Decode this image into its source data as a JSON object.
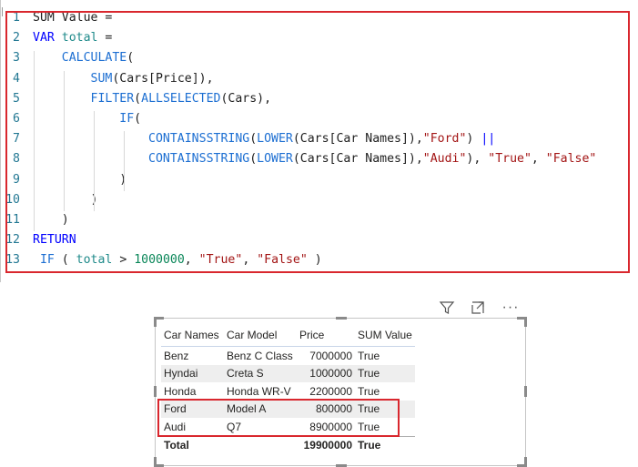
{
  "editor": {
    "lines": [
      {
        "n": "1",
        "tokens": [
          {
            "t": "SUM Value =",
            "c": "plain"
          }
        ]
      },
      {
        "n": "2",
        "tokens": [
          {
            "t": "VAR",
            "c": "kw"
          },
          {
            "t": " total",
            "c": "var"
          },
          {
            "t": " =",
            "c": "plain"
          }
        ]
      },
      {
        "n": "3",
        "tokens": [
          {
            "t": "    ",
            "c": "plain"
          },
          {
            "t": "CALCULATE",
            "c": "fn"
          },
          {
            "t": "(",
            "c": "plain"
          }
        ]
      },
      {
        "n": "4",
        "tokens": [
          {
            "t": "        ",
            "c": "plain"
          },
          {
            "t": "SUM",
            "c": "fn"
          },
          {
            "t": "(Cars[Price]),",
            "c": "plain"
          }
        ]
      },
      {
        "n": "5",
        "tokens": [
          {
            "t": "        ",
            "c": "plain"
          },
          {
            "t": "FILTER",
            "c": "fn"
          },
          {
            "t": "(",
            "c": "plain"
          },
          {
            "t": "ALLSELECTED",
            "c": "fn"
          },
          {
            "t": "(Cars),",
            "c": "plain"
          }
        ]
      },
      {
        "n": "6",
        "tokens": [
          {
            "t": "            ",
            "c": "plain"
          },
          {
            "t": "IF",
            "c": "fn"
          },
          {
            "t": "(",
            "c": "plain"
          }
        ]
      },
      {
        "n": "7",
        "tokens": [
          {
            "t": "                ",
            "c": "plain"
          },
          {
            "t": "CONTAINSSTRING",
            "c": "fn"
          },
          {
            "t": "(",
            "c": "plain"
          },
          {
            "t": "LOWER",
            "c": "fn"
          },
          {
            "t": "(Cars[Car Names]),",
            "c": "plain"
          },
          {
            "t": "\"Ford\"",
            "c": "str"
          },
          {
            "t": ") ",
            "c": "plain"
          },
          {
            "t": "||",
            "c": "kw"
          }
        ]
      },
      {
        "n": "8",
        "tokens": [
          {
            "t": "                ",
            "c": "plain"
          },
          {
            "t": "CONTAINSSTRING",
            "c": "fn"
          },
          {
            "t": "(",
            "c": "plain"
          },
          {
            "t": "LOWER",
            "c": "fn"
          },
          {
            "t": "(Cars[Car Names]),",
            "c": "plain"
          },
          {
            "t": "\"Audi\"",
            "c": "str"
          },
          {
            "t": "), ",
            "c": "plain"
          },
          {
            "t": "\"True\"",
            "c": "str"
          },
          {
            "t": ", ",
            "c": "plain"
          },
          {
            "t": "\"False\"",
            "c": "str"
          }
        ]
      },
      {
        "n": "9",
        "tokens": [
          {
            "t": "            )",
            "c": "plain"
          }
        ]
      },
      {
        "n": "10",
        "tokens": [
          {
            "t": "        )",
            "c": "plain"
          }
        ]
      },
      {
        "n": "11",
        "tokens": [
          {
            "t": "    )",
            "c": "plain"
          }
        ]
      },
      {
        "n": "12",
        "tokens": [
          {
            "t": "RETURN",
            "c": "kw"
          }
        ]
      },
      {
        "n": "13",
        "tokens": [
          {
            "t": " ",
            "c": "plain"
          },
          {
            "t": "IF",
            "c": "fn"
          },
          {
            "t": " ( ",
            "c": "plain"
          },
          {
            "t": "total",
            "c": "var"
          },
          {
            "t": " > ",
            "c": "plain"
          },
          {
            "t": "1000000",
            "c": "num"
          },
          {
            "t": ", ",
            "c": "plain"
          },
          {
            "t": "\"True\"",
            "c": "str"
          },
          {
            "t": ", ",
            "c": "plain"
          },
          {
            "t": "\"False\"",
            "c": "str"
          },
          {
            "t": " )",
            "c": "plain"
          }
        ]
      }
    ]
  },
  "visual_header": {
    "icons": [
      "filter-icon",
      "focus-mode-icon",
      "more-options-icon"
    ],
    "more_label": "···"
  },
  "table": {
    "columns": [
      "Car Names",
      "Car Model",
      "Price",
      "SUM Value"
    ],
    "rows": [
      [
        "Benz",
        "Benz C Class",
        "7000000",
        "True"
      ],
      [
        "Hyndai",
        "Creta S",
        "1000000",
        "True"
      ],
      [
        "Honda",
        "Honda WR-V",
        "2200000",
        "True"
      ],
      [
        "Ford",
        "Model A",
        "800000",
        "True"
      ],
      [
        "Audi",
        "Q7",
        "8900000",
        "True"
      ]
    ],
    "total": [
      "Total",
      "",
      "19900000",
      "True"
    ]
  },
  "colors": {
    "highlight_box": "#d9272e",
    "keyword": "#0000ff",
    "function": "#1d6fd2",
    "string": "#a31515",
    "number": "#098658",
    "variable": "#1f8a8a"
  }
}
